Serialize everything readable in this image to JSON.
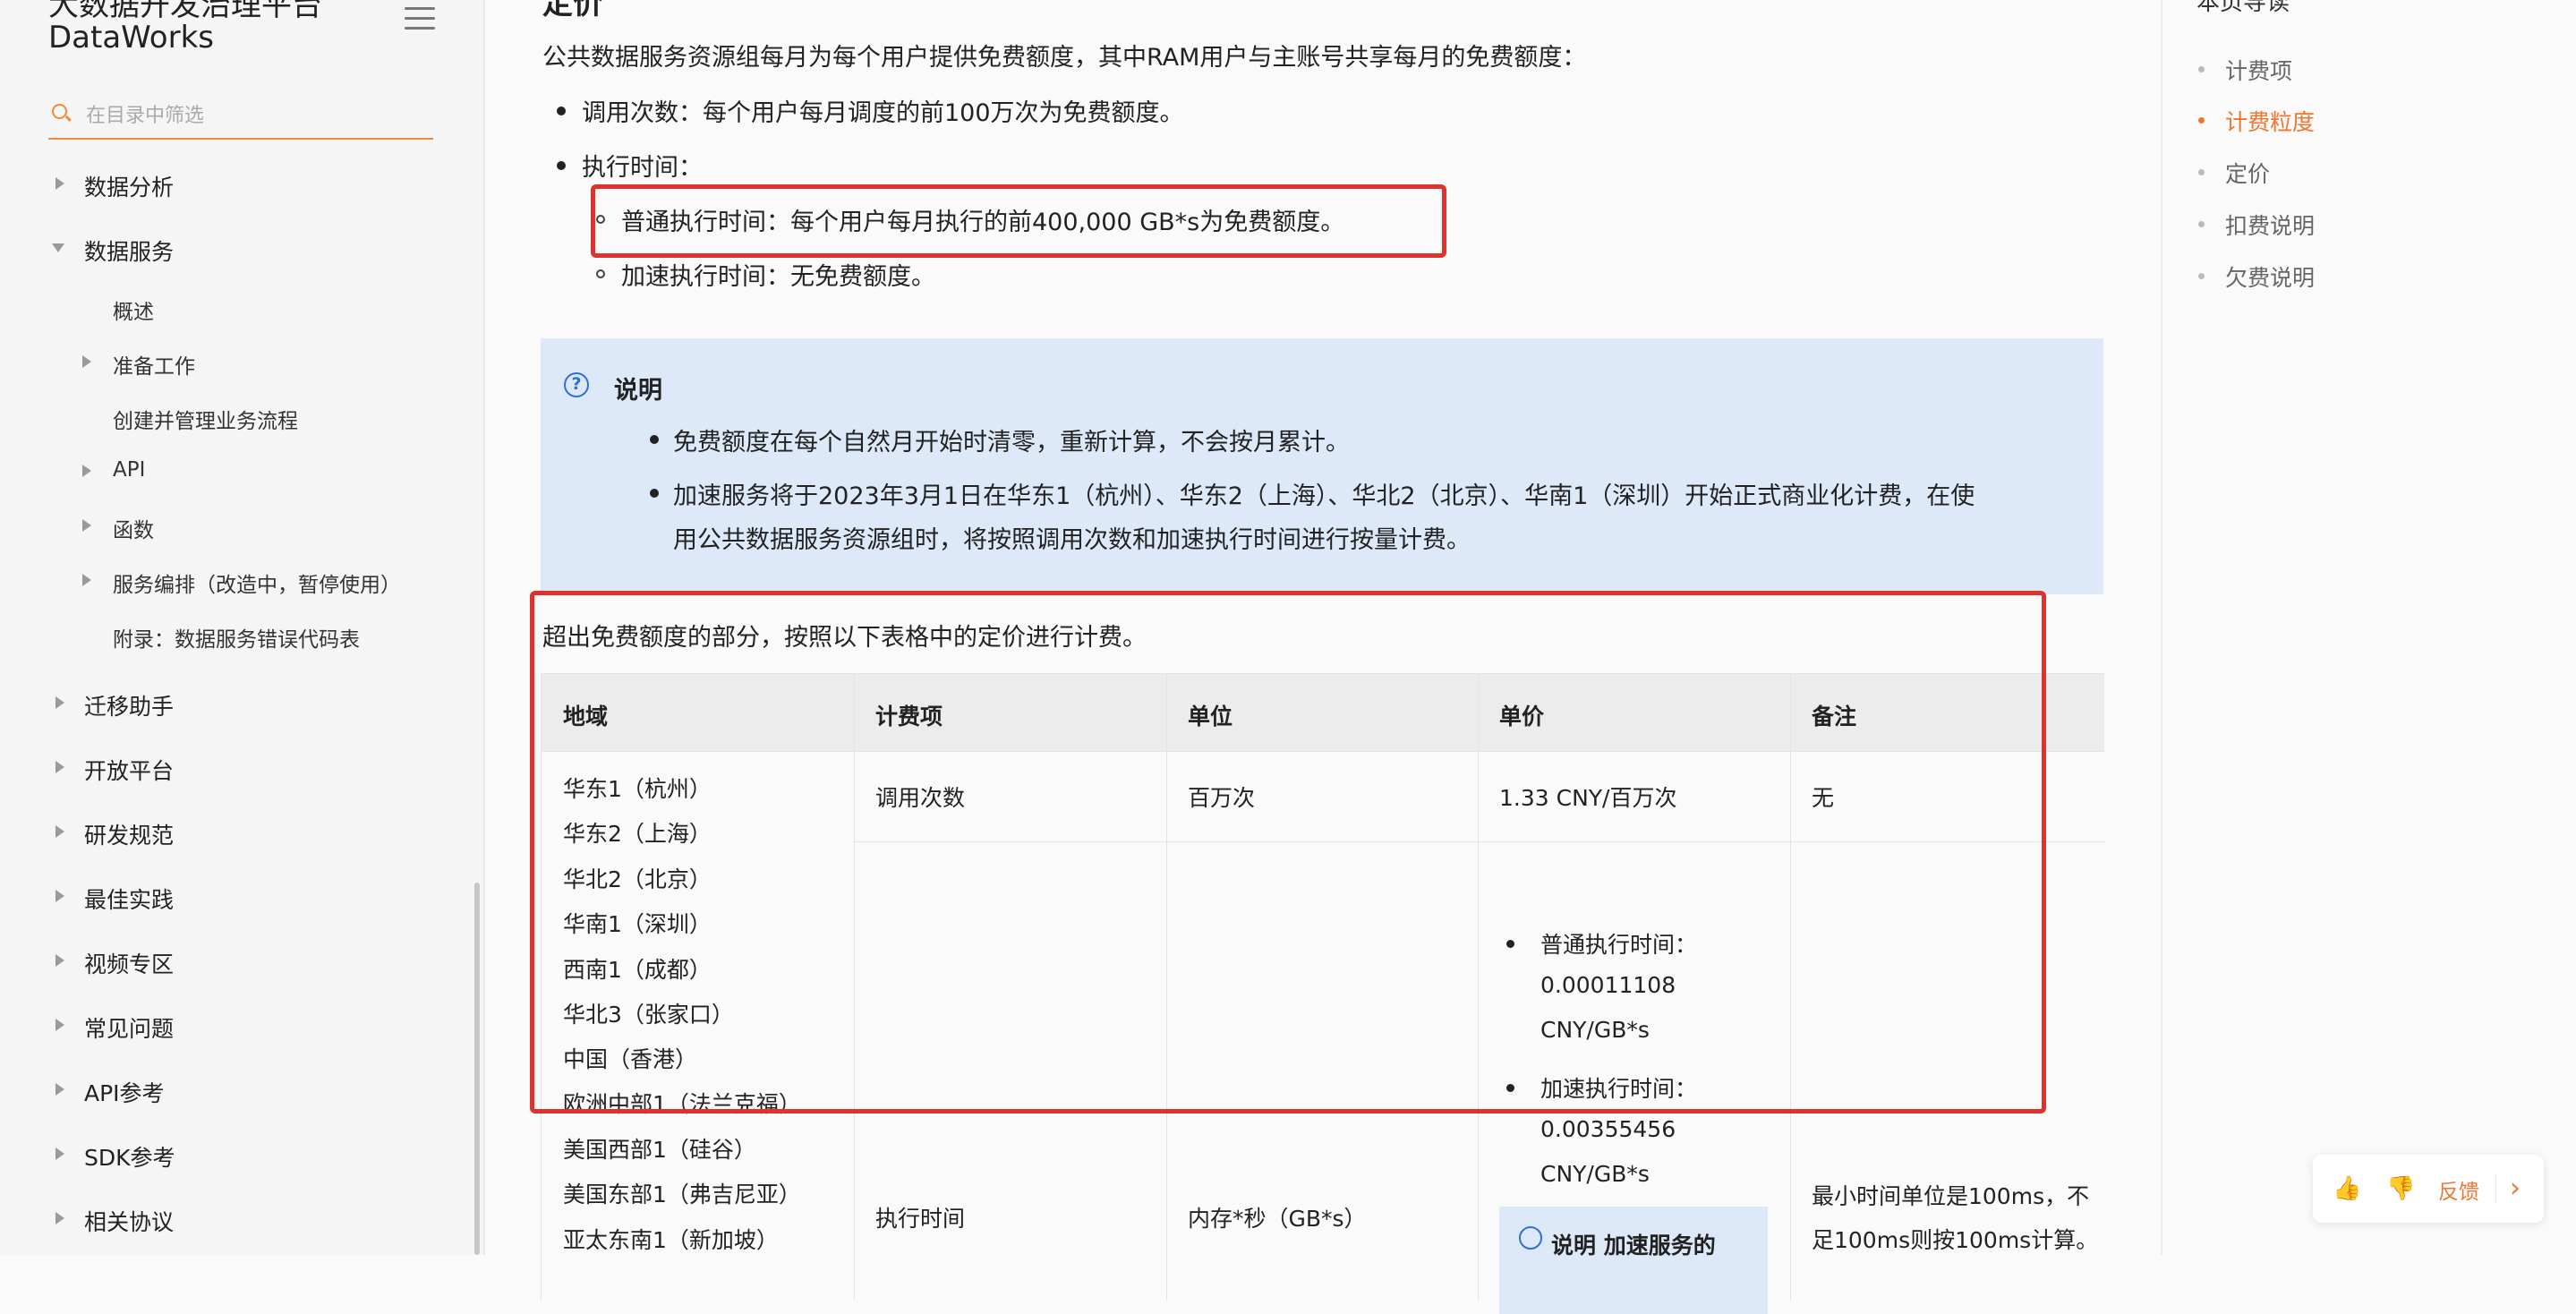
{
  "sidebar": {
    "brand_line1": "大数据开发治理平台",
    "brand_line2": "DataWorks",
    "filter_placeholder": "在目录中筛选",
    "items": [
      {
        "label": "数据分析"
      },
      {
        "label": "数据服务"
      },
      {
        "label": "迁移助手"
      },
      {
        "label": "开放平台"
      },
      {
        "label": "研发规范"
      },
      {
        "label": "最佳实践"
      },
      {
        "label": "视频专区"
      },
      {
        "label": "常见问题"
      },
      {
        "label": "API参考"
      },
      {
        "label": "SDK参考"
      },
      {
        "label": "相关协议"
      }
    ],
    "sub_items": [
      {
        "label": "概述"
      },
      {
        "label": "准备工作"
      },
      {
        "label": "创建并管理业务流程"
      },
      {
        "label": "API"
      },
      {
        "label": "函数"
      },
      {
        "label": "服务编排（改造中，暂停使用）"
      },
      {
        "label": "附录：数据服务错误代码表"
      }
    ]
  },
  "main": {
    "section_title": "定价",
    "intro": "公共数据服务资源组每月为每个用户提供免费额度，其中RAM用户与主账号共享每月的免费额度：",
    "bullet_calls": "调用次数：每个用户每月调度的前100万次为免费额度。",
    "bullet_exec": "执行时间：",
    "sub_normal": "普通执行时间：每个用户每月执行的前400,000 GB*s为免费额度。",
    "sub_accel": "加速执行时间：无免费额度。",
    "note": {
      "title": "说明",
      "bullet1": "免费额度在每个自然月开始时清零，重新计算，不会按月累计。",
      "bullet2_line1": "加速服务将于2023年3月1日在华东1（杭州）、华东2（上海）、华北2（北京）、华南1（深圳）开始正式商业化计费，在使",
      "bullet2_line2": "用公共数据服务资源组时，将按照调用次数和加速执行时间进行按量计费。"
    },
    "table_intro": "超出免费额度的部分，按照以下表格中的定价进行计费。",
    "table": {
      "headers": [
        "地域",
        "计费项",
        "单位",
        "单价",
        "备注"
      ],
      "regions": [
        "华东1（杭州）",
        "华东2（上海）",
        "华北2（北京）",
        "华南1（深圳）",
        "西南1（成都）",
        "华北3（张家口）",
        "中国（香港）",
        "欧洲中部1（法兰克福）",
        "美国西部1（硅谷）",
        "美国东部1（弗吉尼亚）",
        "亚太东南1（新加坡）"
      ],
      "row1": {
        "item": "调用次数",
        "unit": "百万次",
        "price": "1.33 CNY/百万次",
        "remark": "无"
      },
      "row2": {
        "item": "执行时间",
        "unit": "内存*秒（GB*s）",
        "price_normal_label": "普通执行时间：",
        "price_normal_value": "0.00011108",
        "price_normal_unit": "CNY/GB*s",
        "price_accel_label": "加速执行时间：",
        "price_accel_value": "0.00355456",
        "price_accel_unit": "CNY/GB*s",
        "remark_line1": "最小时间单位是100ms，不",
        "remark_line2": "足100ms则按100ms计算。",
        "note_fragment": "说明 加速服务的"
      }
    }
  },
  "toc": {
    "title": "本页导读",
    "items": [
      {
        "label": "计费项"
      },
      {
        "label": "计费粒度"
      },
      {
        "label": "定价"
      },
      {
        "label": "扣费说明"
      },
      {
        "label": "欠费说明"
      }
    ],
    "active_index": 1
  },
  "feedback": {
    "label": "反馈"
  },
  "colors": {
    "accent": "#f0762e",
    "highlight_border": "#e0322c",
    "note_bg": "#dde9f9",
    "note_icon": "#2f6fd9"
  }
}
